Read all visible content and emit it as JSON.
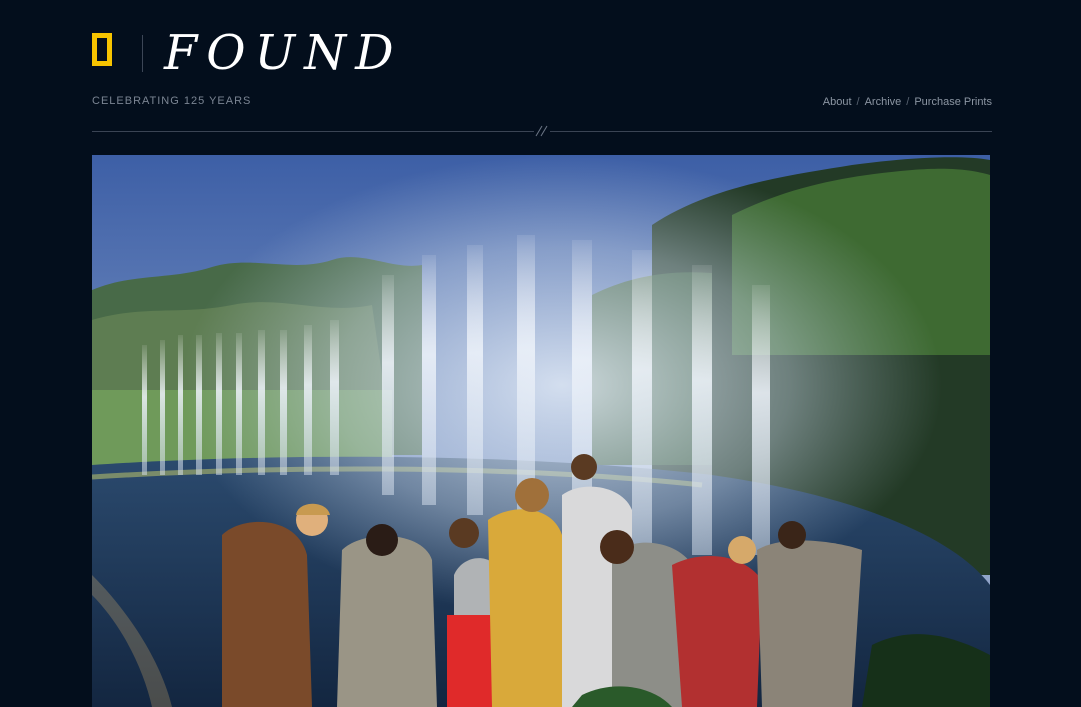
{
  "site": {
    "title": "FOUND",
    "tagline": "CELEBRATING 125 YEARS",
    "brand_color": "#f7c400",
    "background_color": "#030e1c"
  },
  "nav": {
    "items": [
      {
        "label": "About"
      },
      {
        "label": "Archive"
      },
      {
        "label": "Purchase Prints"
      }
    ],
    "separator": "/"
  },
  "photo": {
    "subject": "vintage-color-photo-fountain-with-spectators"
  }
}
